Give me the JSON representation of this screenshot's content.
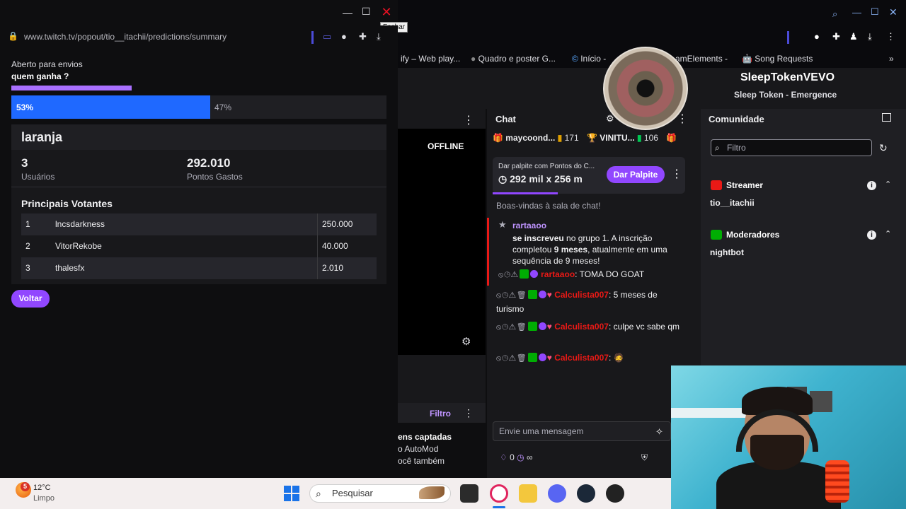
{
  "popout": {
    "url": "www.twitch.tv/popout/tio__itachii/predictions/summary",
    "tooltip": "Fechar",
    "status": "Aberto para envios",
    "question": "quem ganha ?",
    "percent_a": "53%",
    "percent_b": "47%",
    "percent_a_value": 0.53,
    "timer_remaining_fraction": 0.32,
    "outcome": {
      "name": "laranja",
      "users_value": "3",
      "users_label": "Usuários",
      "points_value": "292.010",
      "points_label": "Pontos Gastos"
    },
    "voters_title": "Principais Votantes",
    "voters": [
      {
        "rank": "1",
        "name": "lncsdarkness",
        "points": "250.000"
      },
      {
        "rank": "2",
        "name": "VitorRekobe",
        "points": "40.000"
      },
      {
        "rank": "3",
        "name": "thalesfx",
        "points": "2.010"
      }
    ],
    "back_label": "Voltar"
  },
  "bookmarks": [
    "ify – Web play...",
    "Quadro e poster G...",
    "Início -",
    "amElements -",
    "Song Requests"
  ],
  "player": {
    "offline": "OFFLINE",
    "automod_filter": "Filtro",
    "automod_lines": [
      "ens captadas",
      "o AutoMod",
      "ocê também"
    ]
  },
  "chat": {
    "title": "Chat",
    "gifters": [
      {
        "name": "maycoond...",
        "count": "171"
      },
      {
        "name": "VINITU...",
        "count": "106"
      }
    ],
    "pred_card_title": "Dar palpite com Pontos do C...",
    "pred_card_points": "292 mil x 256 m",
    "pred_card_button": "Dar Palpite",
    "welcome": "Boas-vindas à sala de chat!",
    "sub_user": "rartaaoo",
    "sub_text_1": "se inscreveu",
    "sub_text_2": " no grupo 1. A inscrição completou ",
    "sub_text_3": "9 meses",
    "sub_text_4": ", atualmente em uma sequência de 9 meses!",
    "messages": [
      {
        "user": "rartaaoo",
        "text": ": TOMA DO GOAT"
      },
      {
        "user": "Calculista007",
        "text": ": 5 meses de turismo"
      },
      {
        "user": "Calculista007",
        "text": ": culpe vc sabe qm"
      },
      {
        "user": "Calculista007",
        "text": ":"
      }
    ],
    "input_placeholder": "Envie uma mensagem",
    "footer_points": "0",
    "footer_infinity": "∞"
  },
  "community": {
    "title": "Comunidade",
    "filter_placeholder": "Filtro",
    "streamer_label": "Streamer",
    "streamer_name": "tio__itachii",
    "mods_label": "Moderadores",
    "mod_name": "nightbot"
  },
  "now_playing": {
    "artist": "SleepTokenVEVO",
    "track": "Sleep Token - Emergence"
  },
  "taskbar": {
    "weather_badge": "5",
    "weather_temp": "12°C",
    "weather_desc": "Limpo",
    "search_label": "Pesquisar"
  },
  "colors": {
    "twitch_purple": "#9147ff",
    "prediction_blue": "#1f69ff",
    "mod_green": "#00ad03",
    "username_red": "#e91916"
  }
}
